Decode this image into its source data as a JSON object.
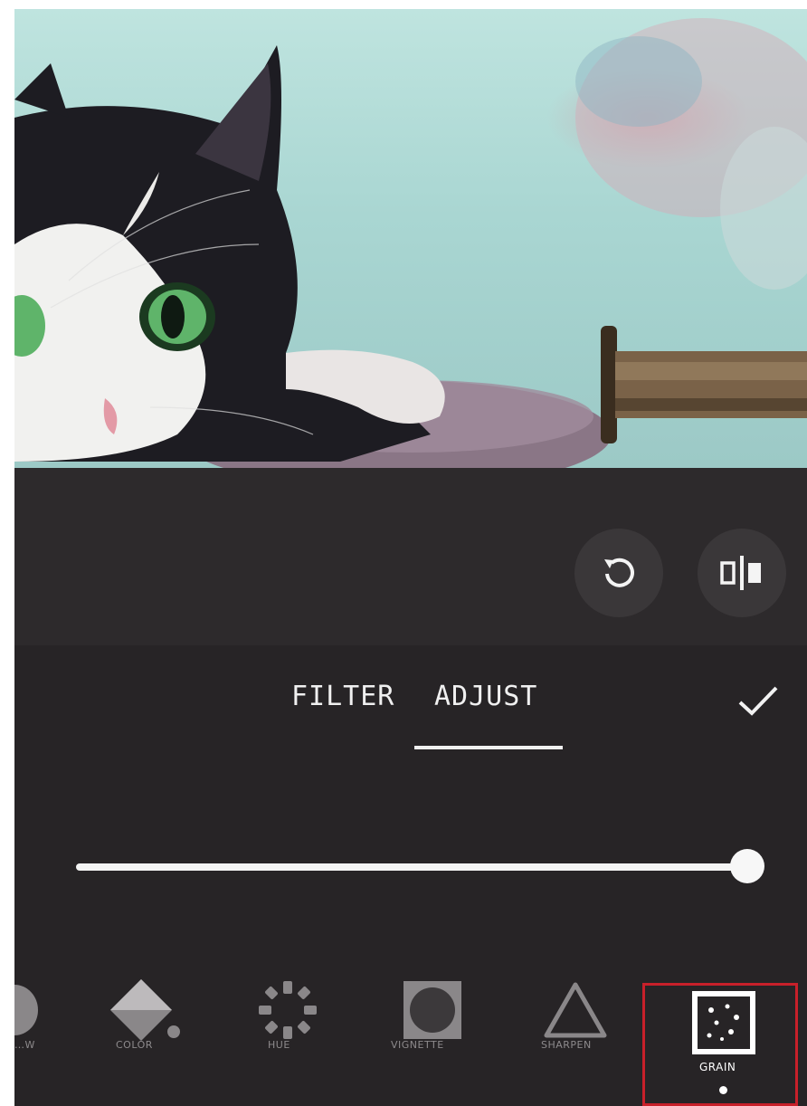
{
  "editor": {
    "tabs": [
      {
        "label": "FILTER",
        "active": false
      },
      {
        "label": "ADJUST",
        "active": true
      }
    ],
    "confirm_icon": "check-icon",
    "rotate_icon": "rotate-icon",
    "compare_icon": "compare-split-icon"
  },
  "slider": {
    "level_fraction": 0.98
  },
  "tools": [
    {
      "label": "…W",
      "icon": "partial-icon",
      "active": false
    },
    {
      "label": "COLOR",
      "icon": "color-fill-icon",
      "active": false
    },
    {
      "label": "HUE",
      "icon": "hue-icon",
      "active": false
    },
    {
      "label": "VIGNETTE",
      "icon": "vignette-icon",
      "active": false
    },
    {
      "label": "SHARPEN",
      "icon": "sharpen-icon",
      "active": false
    },
    {
      "label": "GRAIN",
      "icon": "grain-icon",
      "active": true
    }
  ],
  "colors": {
    "background": "#2a2729",
    "accent_frame": "#c8202a",
    "active_text": "#ffffff",
    "inactive_text": "#8d8a8c"
  }
}
